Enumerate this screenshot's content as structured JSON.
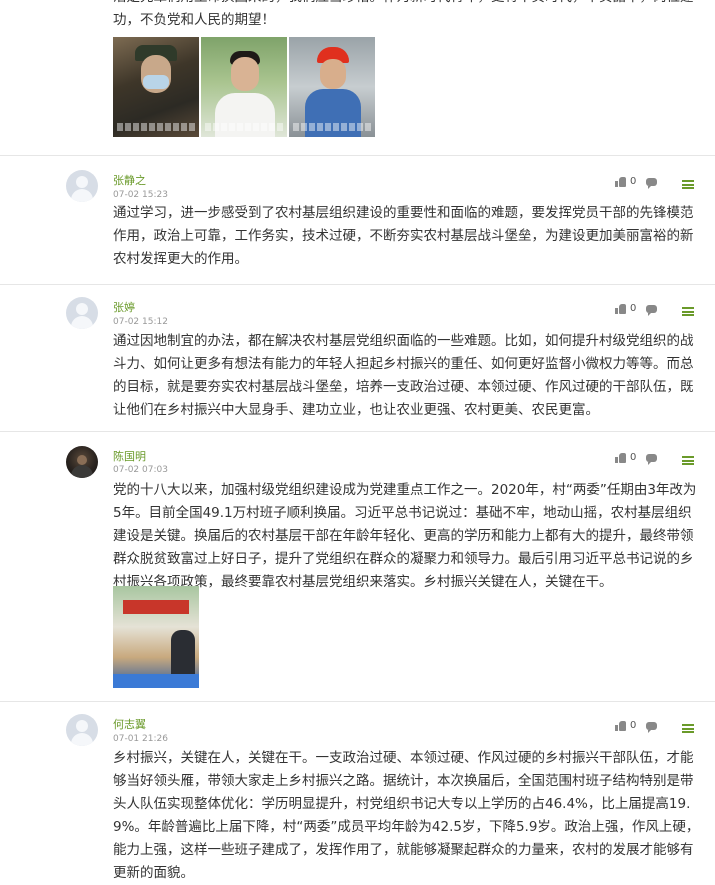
{
  "top_post": {
    "text": "活是先辈们用生命换回来的，我们应当珍惜。作为新时代青年，更将不负时代，不负韶华，岗位建功，不负党和人民的期望！",
    "images": [
      "video-still-1",
      "video-still-2",
      "video-still-3"
    ]
  },
  "icons": {
    "like": "thumb-up-icon",
    "reply": "comment-icon",
    "menu": "menu-icon"
  },
  "colors": {
    "name": "#6a9a2a",
    "accent": "#6a9a2a"
  },
  "comments": [
    {
      "name": "张静之",
      "time": "07-02 15:23",
      "likes": "0",
      "text": "通过学习，进一步感受到了农村基层组织建设的重要性和面临的难题，要发挥党员干部的先锋模范作用，政治上可靠，工作务实，技术过硬，不断夯实农村基层战斗堡垒，为建设更加美丽富裕的新农村发挥更大的作用。"
    },
    {
      "name": "张婷",
      "time": "07-02 15:12",
      "likes": "0",
      "text": "通过因地制宜的办法，都在解决农村基层党组织面临的一些难题。比如，如何提升村级党组织的战斗力、如何让更多有想法有能力的年轻人担起乡村振兴的重任、如何更好监督小微权力等等。而总的目标，就是要夯实农村基层战斗堡垒，培养一支政治过硬、本领过硬、作风过硬的干部队伍，既让他们在乡村振兴中大显身手、建功立业，也让农业更强、农村更美、农民更富。"
    },
    {
      "name": "陈国明",
      "time": "07-02 07:03",
      "likes": "0",
      "text": "党的十八大以来，加强村级党组织建设成为党建重点工作之一。2020年，村“两委”任期由3年改为5年。目前全国49.1万村班子顺利换届。习近平总书记说过：基础不牢，地动山摇，农村基层组织建设是关键。换届后的农村基层干部在年龄年轻化、更高的学历和能力上都有大的提升，最终带领群众脱贫致富过上好日子，提升了党组织在群众的凝聚力和领导力。最后引用习近平总书记说的乡村振兴各项政策，最终要靠农村基层党组织来落实。乡村振兴关键在人，关键在干。"
    },
    {
      "name": "何志翼",
      "time": "07-01 21:26",
      "likes": "0",
      "text": "乡村振兴，关键在人，关键在干。一支政治过硬、本领过硬、作风过硬的乡村振兴干部队伍，才能够当好领头雁，带领大家走上乡村振兴之路。据统计，本次换届后，全国范围村班子结构特别是带头人队伍实现整体优化：学历明显提升，村党组织书记大专以上学历的占46.4%，比上届提高19.9%。年龄普遍比上届下降，村“两委”成员平均年龄为42.5岁，下降5.9岁。政治上强，作风上硬，能力上强，这样一些班子建成了，发挥作用了，就能够凝聚起群众的力量来，农村的发展才能够有更新的面貌。"
    }
  ]
}
